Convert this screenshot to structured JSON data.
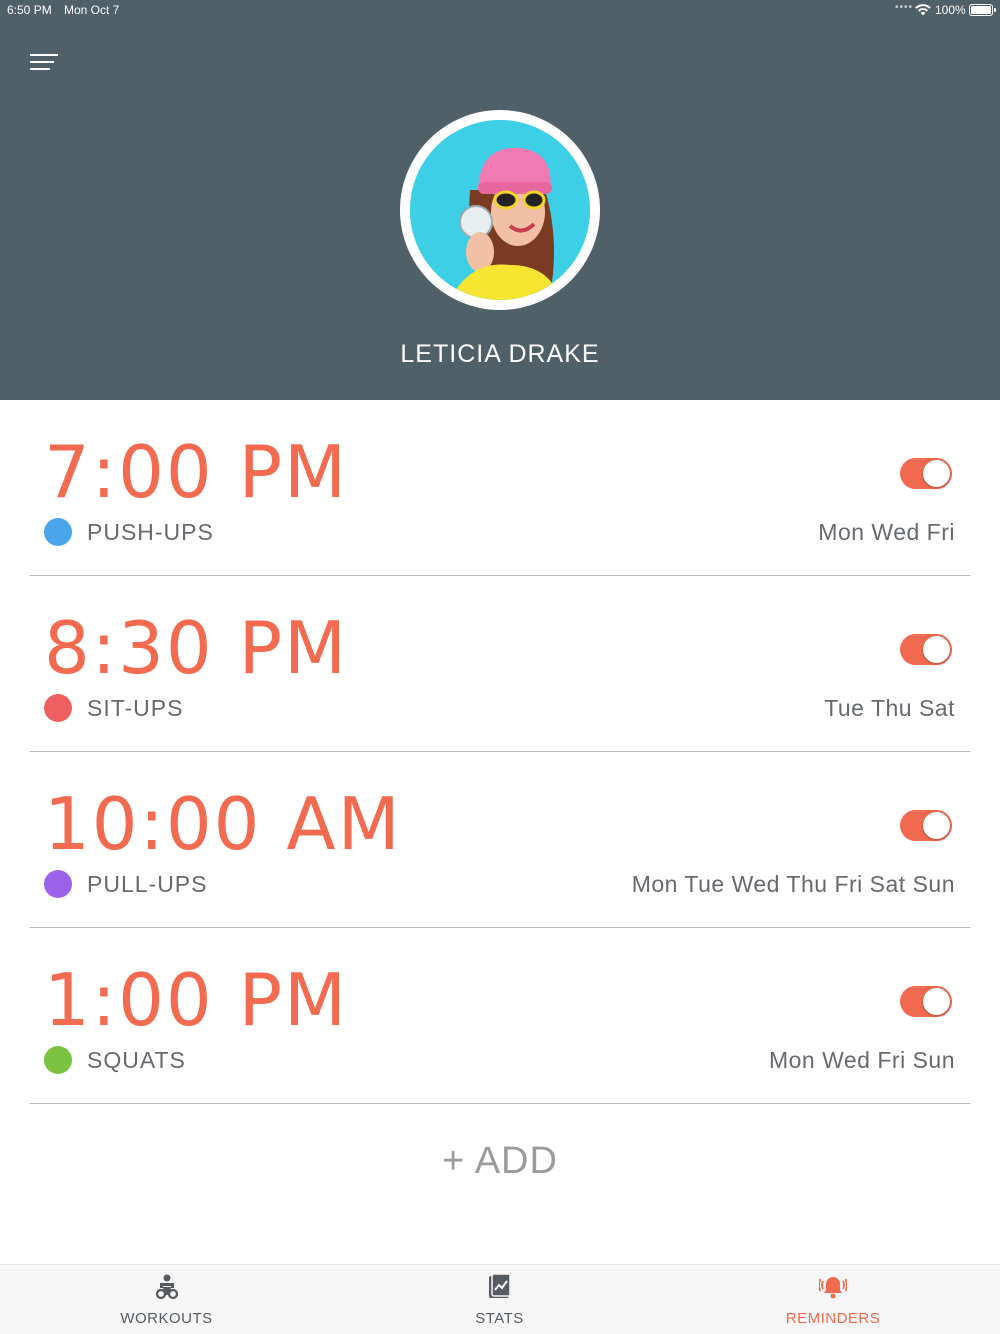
{
  "status_bar": {
    "time": "6:50 PM",
    "date": "Mon Oct 7",
    "battery": "100%"
  },
  "profile": {
    "name": "LETICIA DRAKE"
  },
  "reminders": [
    {
      "time": "7:00 PM",
      "exercise": "PUSH-UPS",
      "days": "Mon Wed Fri",
      "color": "#4aa5ea",
      "enabled": true
    },
    {
      "time": "8:30 PM",
      "exercise": "SIT-UPS",
      "days": "Tue Thu Sat",
      "color": "#ef5f5f",
      "enabled": true
    },
    {
      "time": "10:00 AM",
      "exercise": "PULL-UPS",
      "days": "Mon Tue Wed Thu Fri Sat Sun",
      "color": "#9a62e8",
      "enabled": true
    },
    {
      "time": "1:00 PM",
      "exercise": "SQUATS",
      "days": "Mon Wed Fri Sun",
      "color": "#79c242",
      "enabled": true
    }
  ],
  "add_label": "+ ADD",
  "tabs": [
    {
      "label": "WORKOUTS",
      "icon": "workouts-icon",
      "active": false
    },
    {
      "label": "STATS",
      "icon": "stats-icon",
      "active": false
    },
    {
      "label": "REMINDERS",
      "icon": "reminders-bell-icon",
      "active": true
    }
  ],
  "colors": {
    "header": "#506069",
    "accent": "#f26a4f"
  }
}
